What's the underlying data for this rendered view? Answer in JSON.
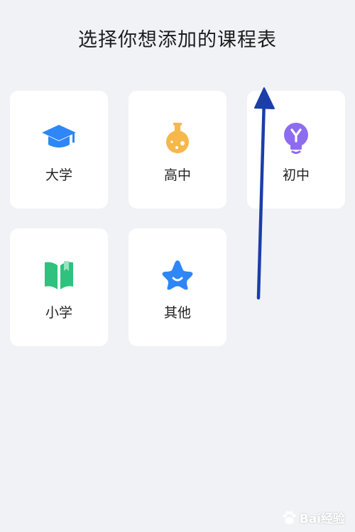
{
  "page": {
    "title": "选择你想添加的课程表"
  },
  "cards": [
    {
      "label": "大学",
      "icon": "graduation-cap-icon",
      "color": "#2f86f6"
    },
    {
      "label": "高中",
      "icon": "flask-icon",
      "color": "#f6b84a"
    },
    {
      "label": "初中",
      "icon": "lightbulb-icon",
      "color": "#8d6cf0"
    },
    {
      "label": "小学",
      "icon": "book-icon",
      "color": "#2ec27e"
    },
    {
      "label": "其他",
      "icon": "star-icon",
      "color": "#2f86f6"
    }
  ],
  "annotation": {
    "arrow_color": "#1b3ea8",
    "arrow": "up-arrow"
  },
  "watermark": {
    "text": "Bai经验"
  }
}
